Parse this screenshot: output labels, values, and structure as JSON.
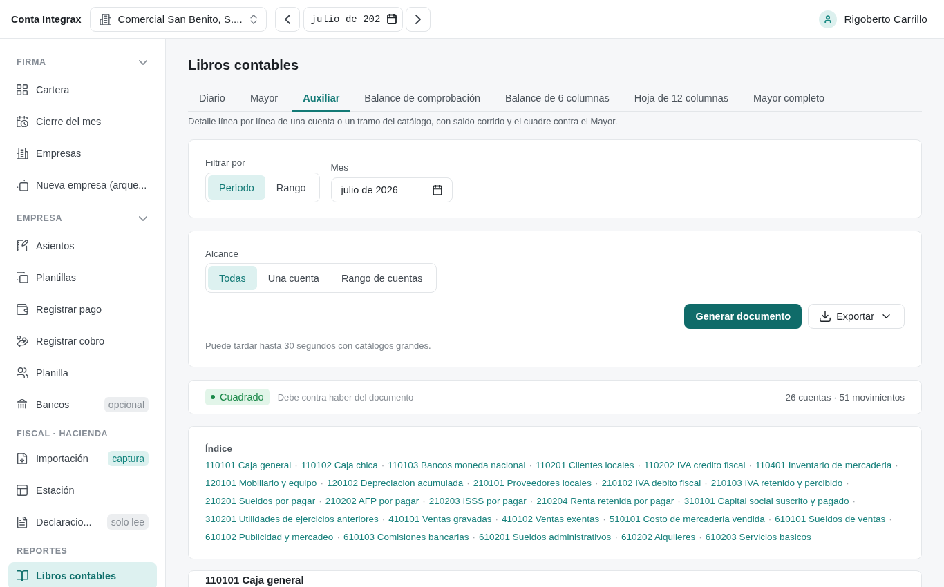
{
  "topbar": {
    "brand": "Conta Integrax",
    "company_select": {
      "value": "Comercial San Benito, S...."
    },
    "month_field": {
      "value": "julio de 202"
    },
    "user": {
      "name": "Rigoberto Carrillo"
    }
  },
  "sidebar": {
    "sections": [
      {
        "title": "FIRMA",
        "kind": "group",
        "expanded": true,
        "items": [
          {
            "label": "Cartera",
            "selected": false
          },
          {
            "label": "Cierre del mes",
            "selected": false
          },
          {
            "label": "Empresas",
            "selected": false
          },
          {
            "label": "Nueva empresa (arque...",
            "selected": false
          }
        ]
      },
      {
        "title": "EMPRESA",
        "kind": "group",
        "expanded": true,
        "items": [
          {
            "label": "Asientos",
            "selected": false
          },
          {
            "label": "Plantillas",
            "selected": false
          },
          {
            "label": "Registrar pago",
            "selected": false
          },
          {
            "label": "Registrar cobro",
            "selected": false
          },
          {
            "label": "Planilla",
            "selected": false
          },
          {
            "label": "Bancos",
            "selected": false,
            "badge": {
              "text": "opcional",
              "kind": "neutral"
            }
          }
        ]
      },
      {
        "title": "FISCAL · HACIENDA",
        "kind": "label",
        "items": [
          {
            "label": "Importación",
            "selected": false,
            "badge": {
              "text": "captura",
              "kind": "accent"
            }
          },
          {
            "label": "Estación",
            "selected": false
          },
          {
            "label": "Declaracio...",
            "selected": false,
            "badge": {
              "text": "solo lee",
              "kind": "neutral"
            }
          }
        ]
      },
      {
        "title": "REPORTES",
        "kind": "label",
        "items": [
          {
            "label": "Libros contables",
            "selected": true
          }
        ]
      }
    ]
  },
  "page": {
    "title": "Libros contables",
    "tabs": [
      {
        "label": "Diario",
        "selected": false
      },
      {
        "label": "Mayor",
        "selected": false
      },
      {
        "label": "Auxiliar",
        "selected": true
      },
      {
        "label": "Balance de comprobación",
        "selected": false
      },
      {
        "label": "Balance de 6 columnas",
        "selected": false
      },
      {
        "label": "Hoja de 12 columnas",
        "selected": false
      },
      {
        "label": "Mayor completo",
        "selected": false
      }
    ],
    "description": "Detalle línea por línea de una cuenta o un tramo del catálogo, con saldo corrido y el cuadre contra el Mayor."
  },
  "filter_card": {
    "filter_label": "Filtrar por",
    "filter_options": [
      {
        "label": "Período",
        "selected": true
      },
      {
        "label": "Rango",
        "selected": false
      }
    ],
    "month_label": "Mes",
    "month_value": "julio de 2026"
  },
  "scope_card": {
    "label": "Alcance",
    "options": [
      {
        "label": "Todas",
        "selected": true
      },
      {
        "label": "Una cuenta",
        "selected": false
      },
      {
        "label": "Rango de cuentas",
        "selected": false
      }
    ],
    "generate_button": "Generar documento",
    "export_button": "Exportar",
    "note": "Puede tardar hasta 30 segundos con catálogos grandes."
  },
  "status_card": {
    "status": {
      "label": "Cuadrado",
      "balanced": true
    },
    "caption": "Debe contra haber del documento",
    "summary": "26 cuentas · 51 movimientos"
  },
  "index_card": {
    "title": "Índice",
    "separator": "·",
    "links": [
      "110101 Caja general",
      "110102 Caja chica",
      "110103 Bancos moneda nacional",
      "110201 Clientes locales",
      "110202 IVA credito fiscal",
      "110401 Inventario de mercaderia",
      "120101 Mobiliario y equipo",
      "120102 Depreciacion acumulada",
      "210101 Proveedores locales",
      "210102 IVA debito fiscal",
      "210103 IVA retenido y percibido",
      "210201 Sueldos por pagar",
      "210202 AFP por pagar",
      "210203 ISSS por pagar",
      "210204 Renta retenida por pagar",
      "310101 Capital social suscrito y pagado",
      "310201 Utilidades de ejercicios anteriores",
      "410101 Ventas gravadas",
      "410102 Ventas exentas",
      "510101 Costo de mercaderia vendida",
      "610101 Sueldos de ventas",
      "610102 Publicidad y mercadeo",
      "610103 Comisiones bancarias",
      "610201 Sueldos administrativos",
      "610202 Alquileres",
      "610203 Servicios basicos"
    ]
  },
  "account_card": {
    "title": "110101 Caja general"
  }
}
